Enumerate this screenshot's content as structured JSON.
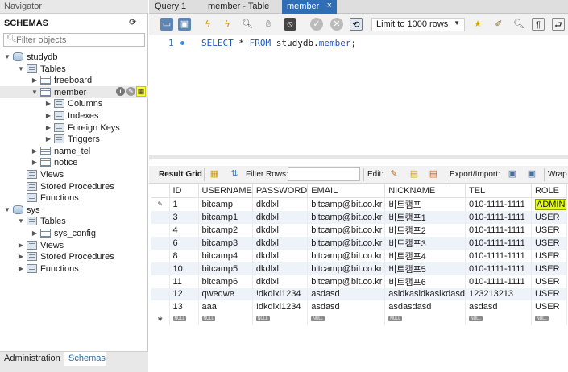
{
  "navigator": {
    "title": "Navigator",
    "schemas_header": "SCHEMAS",
    "filter_placeholder": "Filter objects",
    "tree": [
      {
        "label": "studydb",
        "level": 0,
        "icon": "database-icon",
        "expanded": true
      },
      {
        "label": "Tables",
        "level": 1,
        "icon": "folder-icon",
        "expanded": true
      },
      {
        "label": "freeboard",
        "level": 2,
        "icon": "table-icon",
        "expanded": false
      },
      {
        "label": "member",
        "level": 2,
        "icon": "table-icon",
        "expanded": true
      },
      {
        "label": "Columns",
        "level": 3,
        "icon": "folder-icon",
        "expanded": false
      },
      {
        "label": "Indexes",
        "level": 3,
        "icon": "folder-icon",
        "expanded": false
      },
      {
        "label": "Foreign Keys",
        "level": 3,
        "icon": "folder-icon",
        "expanded": false
      },
      {
        "label": "Triggers",
        "level": 3,
        "icon": "folder-icon",
        "expanded": false
      },
      {
        "label": "name_tel",
        "level": 2,
        "icon": "table-icon",
        "expanded": false
      },
      {
        "label": "notice",
        "level": 2,
        "icon": "table-icon",
        "expanded": false
      },
      {
        "label": "Views",
        "level": 1,
        "icon": "folder-icon",
        "expanded": null
      },
      {
        "label": "Stored Procedures",
        "level": 1,
        "icon": "folder-icon",
        "expanded": null
      },
      {
        "label": "Functions",
        "level": 1,
        "icon": "folder-icon",
        "expanded": null
      },
      {
        "label": "sys",
        "level": 0,
        "icon": "database-icon",
        "expanded": true
      },
      {
        "label": "Tables",
        "level": 1,
        "icon": "folder-icon",
        "expanded": true
      },
      {
        "label": "sys_config",
        "level": 2,
        "icon": "table-icon",
        "expanded": false
      },
      {
        "label": "Views",
        "level": 1,
        "icon": "folder-icon",
        "expanded": false
      },
      {
        "label": "Stored Procedures",
        "level": 1,
        "icon": "folder-icon",
        "expanded": false
      },
      {
        "label": "Functions",
        "level": 1,
        "icon": "folder-icon",
        "expanded": false
      }
    ],
    "bottom_tabs": {
      "administration": "Administration",
      "schemas": "Schemas"
    }
  },
  "tabs": [
    {
      "label": "Query 1",
      "active": false
    },
    {
      "label": "member - Table",
      "active": false
    },
    {
      "label": "member",
      "active": true,
      "close": "×"
    }
  ],
  "toolbar": {
    "limit_label": "Limit to 1000 rows"
  },
  "editor": {
    "line_number": "1",
    "sql_select": "SELECT",
    "sql_star": " * ",
    "sql_from": "FROM",
    "sql_rest": " studydb.",
    "sql_table": "member",
    "sql_end": ";"
  },
  "result_toolbar": {
    "result_grid": "Result Grid",
    "filter_rows": "Filter Rows:",
    "edit": "Edit:",
    "export_import": "Export/Import:",
    "wrap": "Wrap"
  },
  "grid": {
    "columns": [
      "ID",
      "USERNAME",
      "PASSWORD",
      "EMAIL",
      "NICKNAME",
      "TEL",
      "ROLE"
    ],
    "rows": [
      [
        "1",
        "bitcamp",
        "dkdlxl",
        "bitcamp@bit.co.kr",
        "비트캠프",
        "010-1111-1111",
        "ADMIN"
      ],
      [
        "3",
        "bitcamp1",
        "dkdlxl",
        "bitcamp@bit.co.kr",
        "비트캠프1",
        "010-1111-1111",
        "USER"
      ],
      [
        "4",
        "bitcamp2",
        "dkdlxl",
        "bitcamp@bit.co.kr",
        "비트캠프2",
        "010-1111-1111",
        "USER"
      ],
      [
        "6",
        "bitcamp3",
        "dkdlxl",
        "bitcamp@bit.co.kr",
        "비트캠프3",
        "010-1111-1111",
        "USER"
      ],
      [
        "8",
        "bitcamp4",
        "dkdlxl",
        "bitcamp@bit.co.kr",
        "비트캠프4",
        "010-1111-1111",
        "USER"
      ],
      [
        "10",
        "bitcamp5",
        "dkdlxl",
        "bitcamp@bit.co.kr",
        "비트캠프5",
        "010-1111-1111",
        "USER"
      ],
      [
        "11",
        "bitcamp6",
        "dkdlxl",
        "bitcamp@bit.co.kr",
        "비트캠프6",
        "010-1111-1111",
        "USER"
      ],
      [
        "12",
        "qweqwe",
        "!dkdlxl1234",
        "asdasd",
        "asldkasldkaslkdasd",
        "123213213",
        "USER"
      ],
      [
        "13",
        "aaa",
        "!dkdlxl1234",
        "asdasd",
        "asdasdasd",
        "asdasd",
        "USER"
      ]
    ],
    "null_label": "NULL",
    "edit_marker": "✎",
    "new_marker": "✱"
  }
}
